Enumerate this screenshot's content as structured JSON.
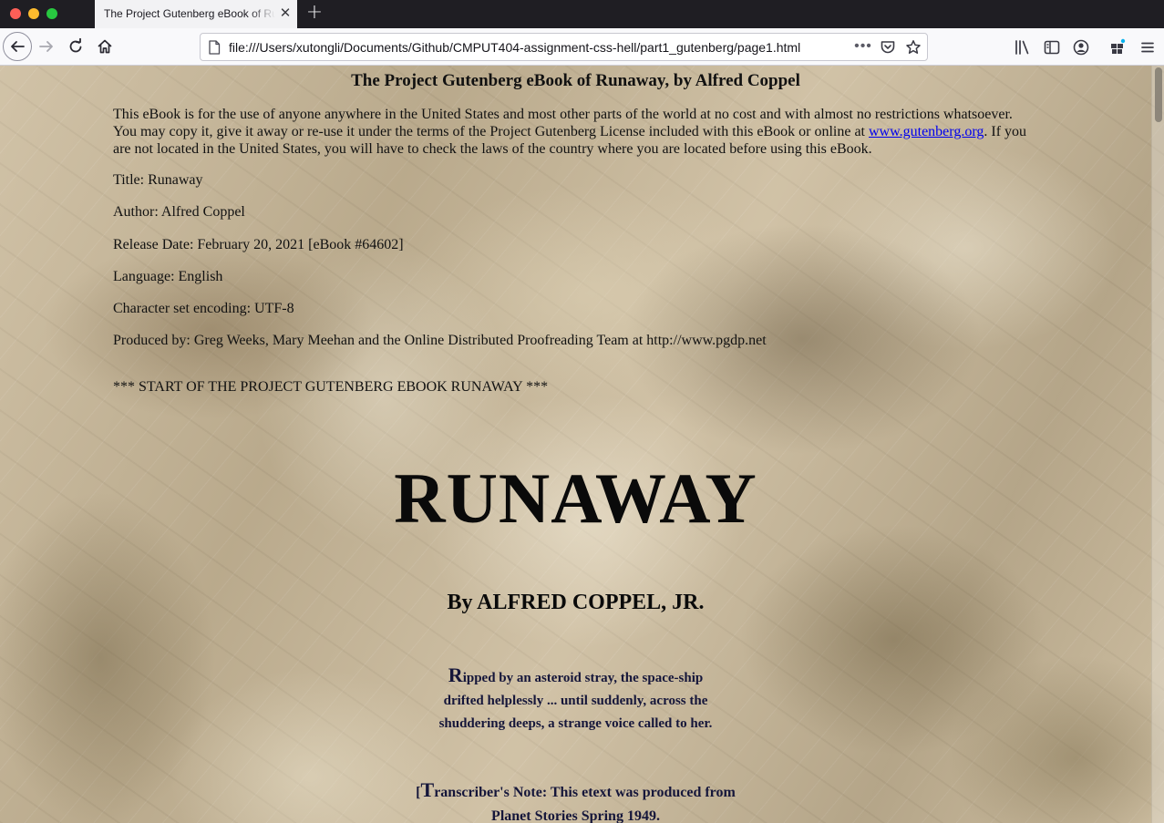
{
  "browser": {
    "tab_title": "The Project Gutenberg eBook of Runaway, by Alfred Coppel",
    "tab_close": "✕",
    "new_tab": "+",
    "url": "file:///Users/xutongli/Documents/Github/CMPUT404-assignment-css-hell/part1_gutenberg/page1.html",
    "url_more": "•••"
  },
  "page": {
    "heading": "The Project Gutenberg eBook of Runaway, by Alfred Coppel",
    "intro_before_link": "This eBook is for the use of anyone anywhere in the United States and most other parts of the world at no cost and with almost no restrictions whatsoever. You may copy it, give it away or re-use it under the terms of the Project Gutenberg License included with this eBook or online at ",
    "intro_link": "www.gutenberg.org",
    "intro_after_link": ". If you are not located in the United States, you will have to check the laws of the country where you are located before using this eBook.",
    "meta": {
      "title": "Title: Runaway",
      "author": "Author: Alfred Coppel",
      "release_date": "Release Date: February 20, 2021 [eBook #64602]",
      "language": "Language: English",
      "encoding": "Character set encoding: UTF-8",
      "produced_by": "Produced by: Greg Weeks, Mary Meehan and the Online Distributed Proofreading Team at http://www.pgdp.net"
    },
    "start_marker": "*** START OF THE PROJECT GUTENBERG EBOOK RUNAWAY ***",
    "book_title": "RUNAWAY",
    "byline": "By ALFRED COPPEL, JR.",
    "blurb": {
      "dropcap": "R",
      "line1": "ipped by an asteroid stray, the space-ship",
      "line2": "drifted helplessly ... until suddenly, across the",
      "line3": "shuddering deeps, a strange voice called to her."
    },
    "transcriber_note": {
      "bracket": "[",
      "dropcap": "T",
      "line1": "ranscriber's Note: This etext was produced from",
      "line2": "Planet Stories Spring 1949."
    }
  },
  "colors": {
    "link": "#0000ee",
    "tab_bar": "#1f1e23",
    "nav_bar": "#f9f9fb"
  }
}
